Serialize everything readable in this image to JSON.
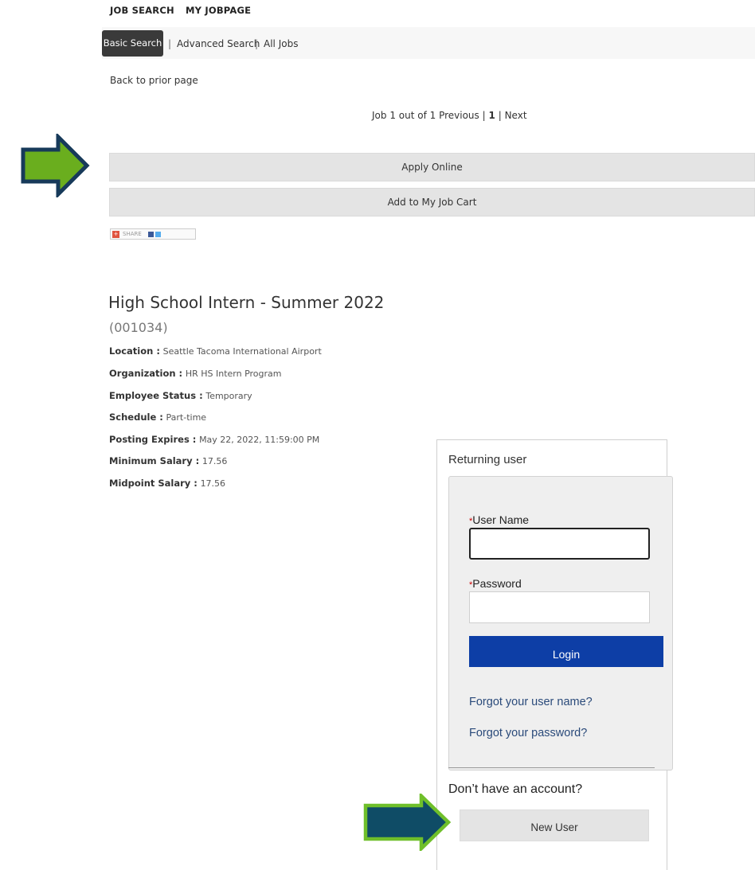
{
  "nav": {
    "job_search": "JOB SEARCH",
    "my_jobpage": "MY JOBPAGE"
  },
  "subnav": {
    "basic": "Basic Search",
    "sep1": "|",
    "advanced": "Advanced Search",
    "sep2": "|",
    "all": "All Jobs"
  },
  "back_link": "Back to prior page",
  "pager": {
    "prefix": "Job 1 out of 1",
    "previous": "Previous",
    "sep1": "|",
    "current": "1",
    "sep2": "|",
    "next": "Next"
  },
  "actions": {
    "apply": "Apply Online",
    "add_cart": "Add to My Job Cart"
  },
  "share": {
    "plus": "+",
    "label": "SHARE"
  },
  "job": {
    "title": "High School Intern - Summer 2022",
    "id": "(001034)",
    "details": [
      {
        "key": "Location :",
        "value": "Seattle Tacoma International Airport"
      },
      {
        "key": "Organization :",
        "value": "HR HS Intern Program"
      },
      {
        "key": "Employee Status :",
        "value": "Temporary"
      },
      {
        "key": "Schedule :",
        "value": "Part-time"
      },
      {
        "key": "Posting Expires :",
        "value": "May 22, 2022, 11:59:00 PM"
      },
      {
        "key": "Minimum Salary :",
        "value": "17.56"
      },
      {
        "key": "Midpoint Salary :",
        "value": "17.56"
      }
    ]
  },
  "login": {
    "heading": "Returning user",
    "required_mark": "*",
    "username_label": "User Name",
    "username_value": "",
    "password_label": "Password",
    "password_value": "",
    "login_button": "Login",
    "forgot_username": "Forgot your user name?",
    "forgot_password": "Forgot your password?",
    "no_account": "Don’t have an account?",
    "new_user": "New User"
  },
  "colors": {
    "arrow_fill_green": "#6aae1e",
    "arrow_outline_navy": "#173a5a",
    "arrow_fill_navy": "#0f4c66",
    "arrow_outline_green": "#6fbf2a",
    "login_button": "#0d3ea6",
    "required": "#cc0000"
  }
}
